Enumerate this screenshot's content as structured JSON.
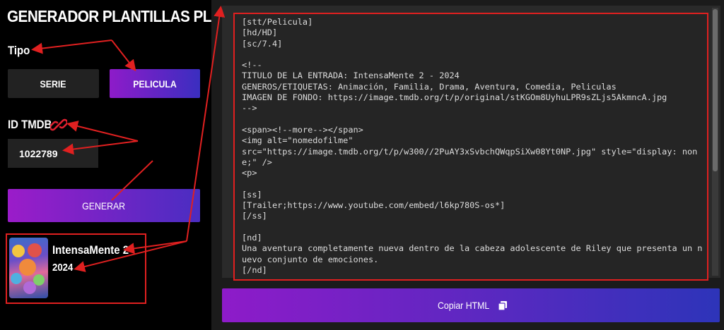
{
  "app": {
    "title": "GENERADOR PLANTILLAS PLUS"
  },
  "form": {
    "tipo_label": "Tipo",
    "serie_label": "SERIE",
    "pelicula_label": "PELICULA",
    "selected_type": "PELICULA",
    "id_label": "ID TMDB",
    "id_value": "1022789",
    "generar_label": "GENERAR"
  },
  "result": {
    "title": "IntensaMente 2",
    "year": "2024"
  },
  "code": {
    "text": "[stt/Pelicula]\n[hd/HD]\n[sc/7.4]\n\n<!--\nTITULO DE LA ENTRADA: IntensaMente 2 - 2024\nGENEROS/ETIQUETAS: Animación, Familia, Drama, Aventura, Comedia, Peliculas\nIMAGEN DE FONDO: https://image.tmdb.org/t/p/original/stKGOm8UyhuLPR9sZLjs5AkmncA.jpg\n-->\n\n<span><!--more--></span>\n<img alt=\"nomedofilme\"\nsrc=\"https://image.tmdb.org/t/p/w300//2PuAY3xSvbchQWqpSiXw08Yt0NP.jpg\" style=\"display: none;\" />\n<p>\n\n[ss]\n[Trailer;https://www.youtube.com/embed/l6kp780S-os*]\n[/ss]\n\n[nd]\nUna aventura completamente nueva dentro de la cabeza adolescente de Riley que presenta un nuevo conjunto de emociones.\n[/nd]"
  },
  "actions": {
    "copy_label": "Copiar HTML"
  },
  "icons": {
    "link": "link-icon",
    "copy": "copy-icon",
    "poster": "movie-poster"
  },
  "colors": {
    "accent_start": "#8e1bc9",
    "accent_end": "#2d34b9",
    "annotation": "#e02020",
    "panel_bg": "#1b1b1b"
  }
}
